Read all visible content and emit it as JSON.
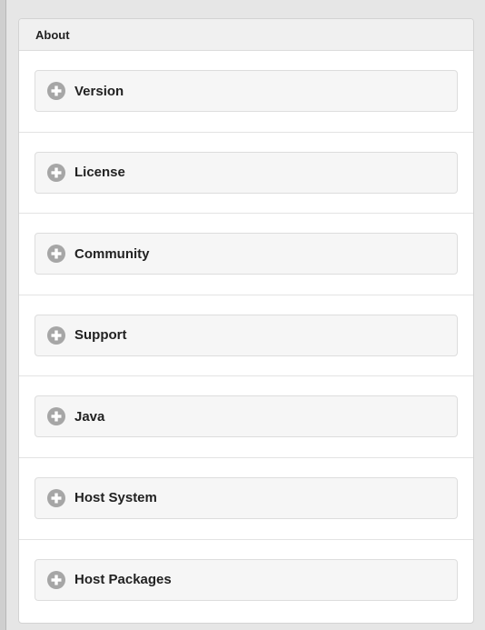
{
  "panel": {
    "title": "About"
  },
  "sections": [
    {
      "label": "Version"
    },
    {
      "label": "License"
    },
    {
      "label": "Community"
    },
    {
      "label": "Support"
    },
    {
      "label": "Java"
    },
    {
      "label": "Host System"
    },
    {
      "label": "Host Packages"
    }
  ],
  "icons": {
    "expand": "plus-circle-icon"
  },
  "colors": {
    "icon_gray": "#a6a6a6",
    "header_bg": "#f0f0f0",
    "collapsible_bg": "#f6f6f6"
  }
}
